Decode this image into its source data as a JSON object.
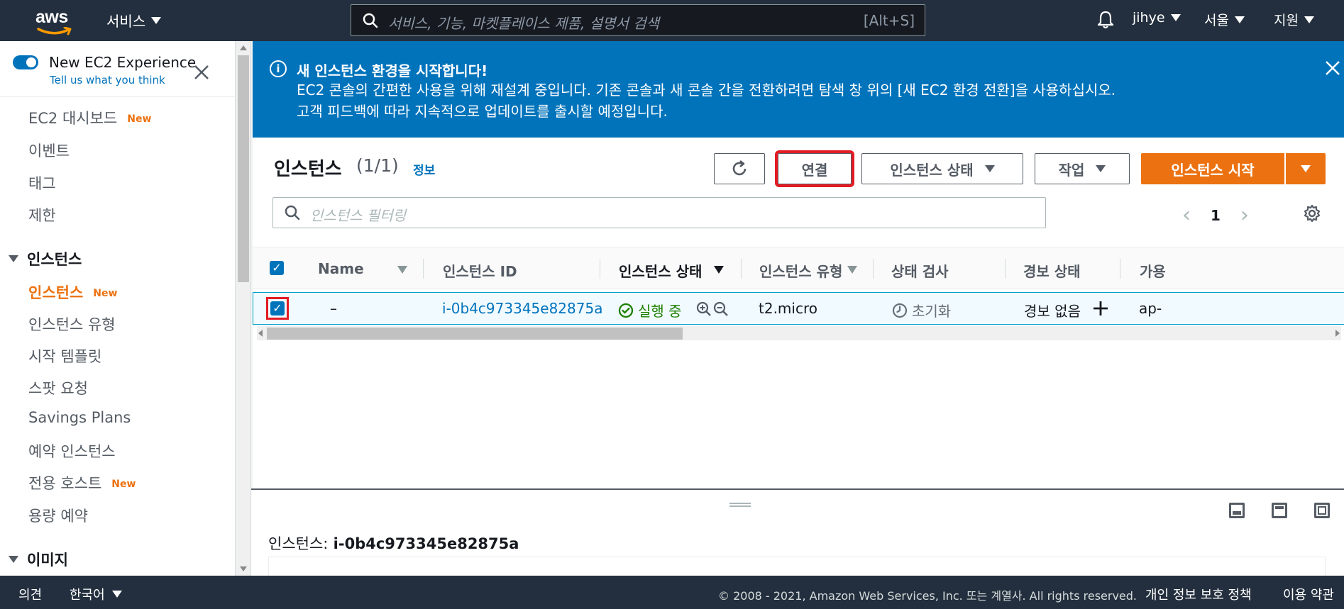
{
  "topnav": {
    "logo_text": "aws",
    "services": "서비스",
    "search_placeholder": "서비스, 기능, 마켓플레이스 제품, 설명서 검색",
    "search_shortcut": "[Alt+S]",
    "user": "jihye",
    "region": "서울",
    "support": "지원"
  },
  "sidebar": {
    "experience_title": "New EC2 Experience",
    "experience_link": "Tell us what you think",
    "new_badge": "New",
    "items": [
      {
        "label": "EC2 대시보드",
        "new": true
      },
      {
        "label": "이벤트"
      },
      {
        "label": "태그"
      },
      {
        "label": "제한"
      }
    ],
    "section_instances": "인스턴스",
    "instance_items": [
      {
        "label": "인스턴스",
        "new": true,
        "active": true
      },
      {
        "label": "인스턴스 유형"
      },
      {
        "label": "시작 템플릿"
      },
      {
        "label": "스팟 요청"
      },
      {
        "label": "Savings Plans"
      },
      {
        "label": "예약 인스턴스"
      },
      {
        "label": "전용 호스트",
        "new": true
      },
      {
        "label": "용량 예약"
      }
    ],
    "section_images": "이미지"
  },
  "flash": {
    "title": "새 인스턴스 환경을 시작합니다!",
    "body": "EC2 콘솔의 간편한 사용을 위해 재설계 중입니다. 기존 콘솔과 새 콘솔 간을 전환하려면 탐색 창 위의 [새 EC2 환경 전환]을 사용하십시오. 고객 피드백에 따라 지속적으로 업데이트를 출시할 예정입니다.",
    "info_glyph": "i"
  },
  "panel": {
    "title": "인스턴스",
    "count": "(1/1)",
    "info": "정보",
    "buttons": {
      "connect": "연결",
      "instance_state": "인스턴스 상태",
      "actions": "작업",
      "launch": "인스턴스 시작"
    },
    "filter_placeholder": "인스턴스 필터링",
    "page": "1"
  },
  "table": {
    "columns": [
      "Name",
      "인스턴스 ID",
      "인스턴스 상태",
      "인스턴스 유형",
      "상태 검사",
      "경보 상태",
      "가용"
    ],
    "rows": [
      {
        "name": "–",
        "instance_id": "i-0b4c973345e82875a",
        "state": "실행 중",
        "type": "t2.micro",
        "status_check": "초기화",
        "alarm": "경보 없음",
        "az": "ap-"
      }
    ]
  },
  "split_panel": {
    "label": "인스턴스:",
    "instance_id": "i-0b4c973345e82875a"
  },
  "footer": {
    "feedback": "의견",
    "language": "한국어",
    "copyright": "© 2008 - 2021, Amazon Web Services, Inc. 또는 계열사. All rights reserved.",
    "privacy": "개인 정보 보호 정책",
    "terms": "이용 약관"
  },
  "colors": {
    "nav_bg": "#232f3e",
    "accent_blue": "#0073bb",
    "orange": "#ec7211",
    "running_green": "#1d8102",
    "highlight_red": "#e31b23"
  }
}
